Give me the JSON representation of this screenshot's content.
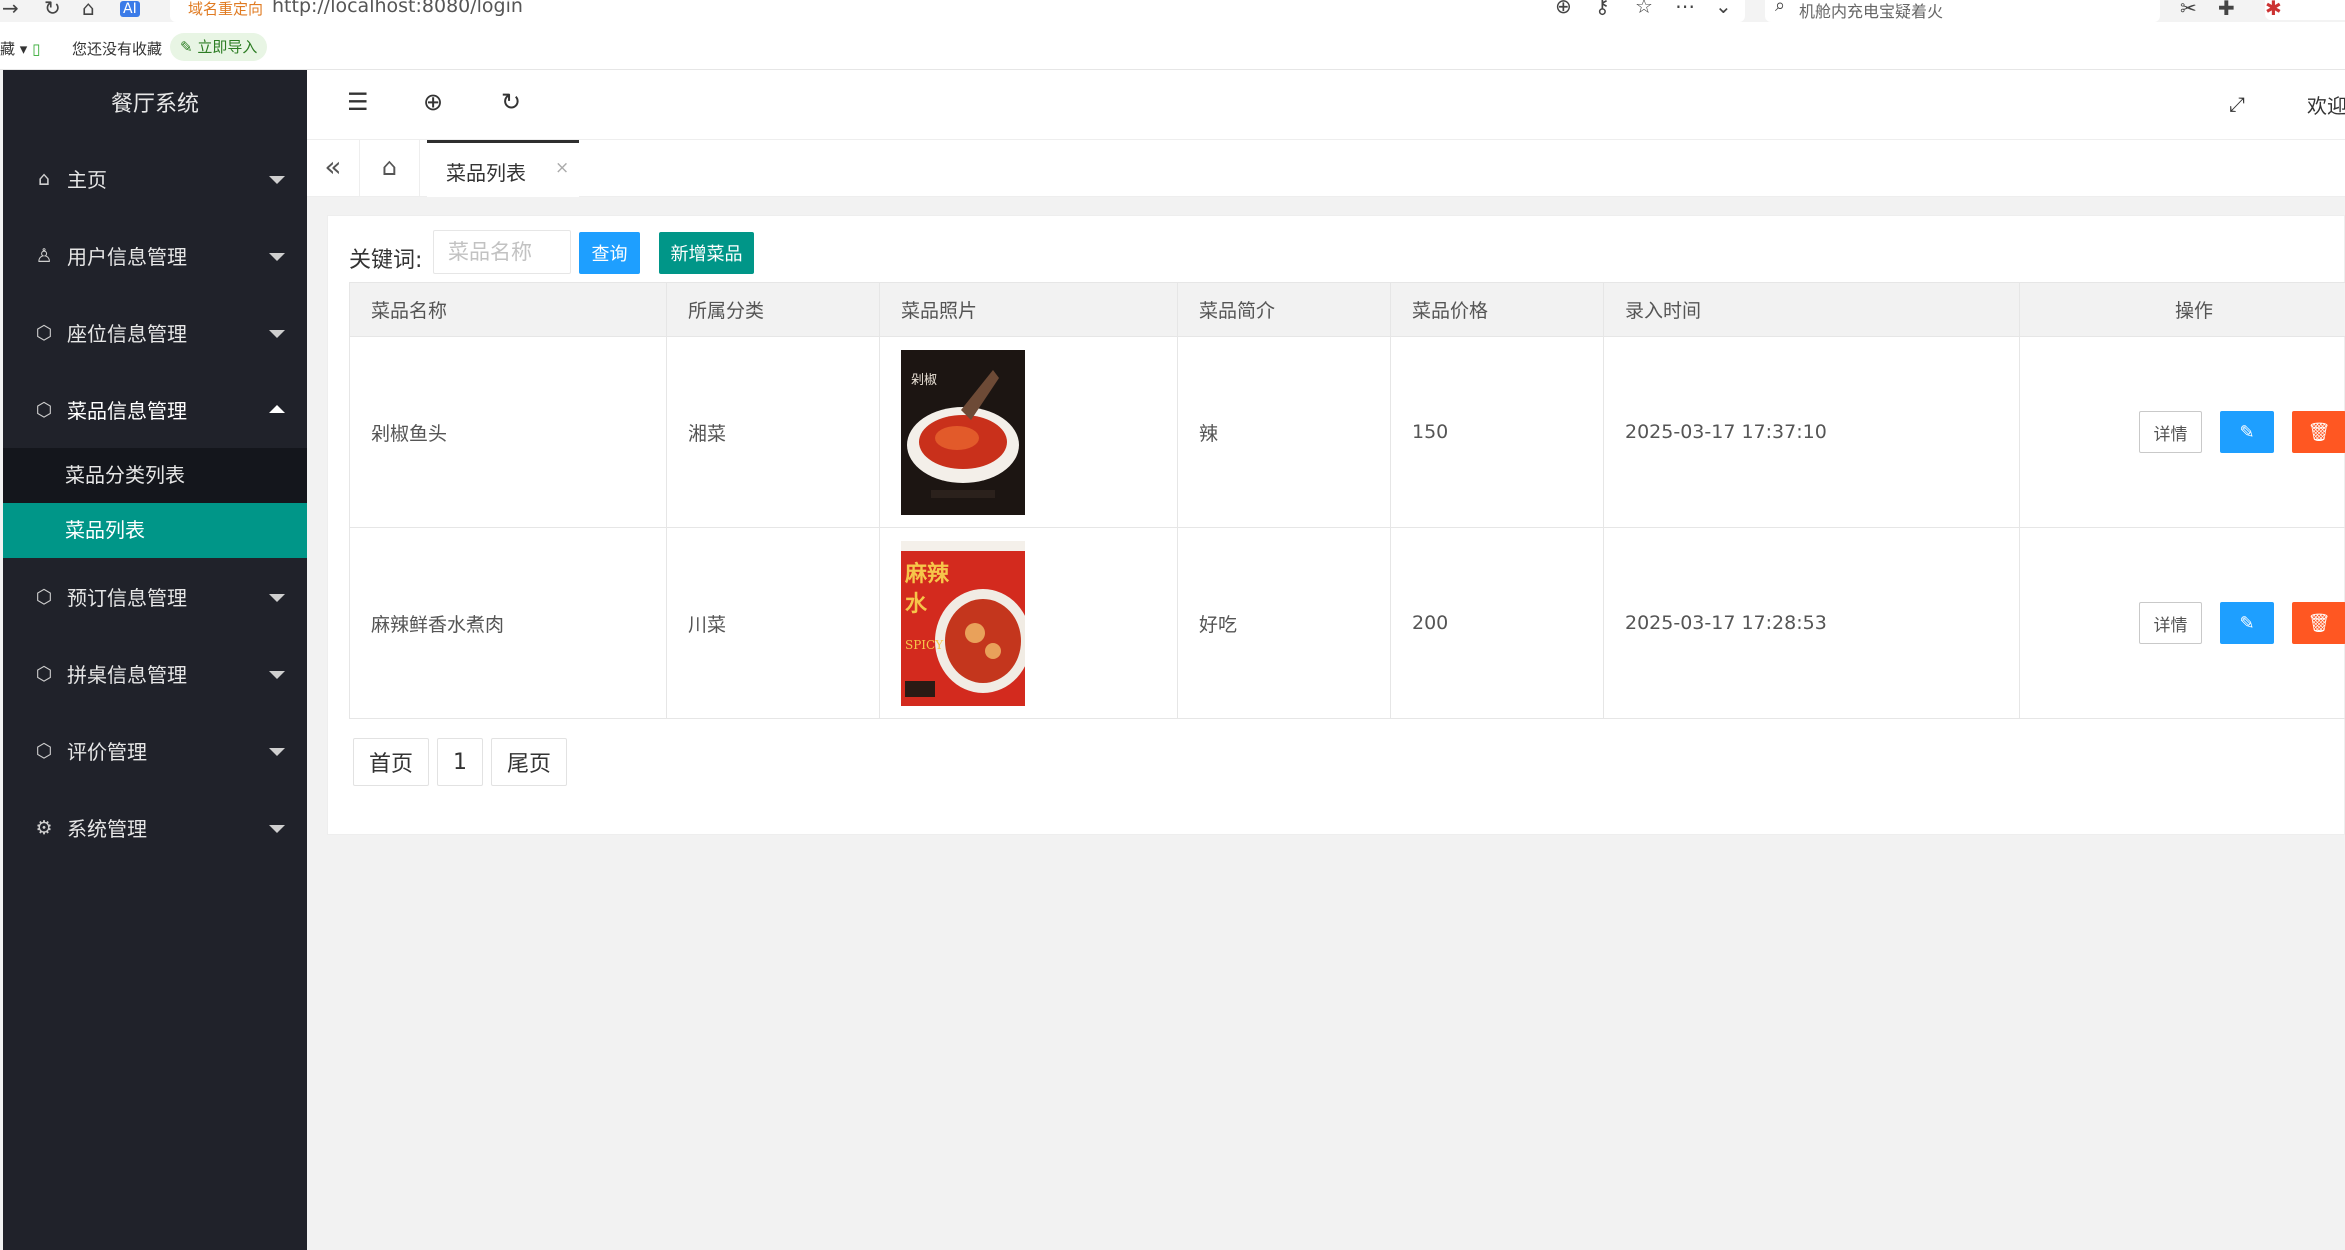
{
  "browser": {
    "address_warning": "域名重定向",
    "url": "http://localhost:8080/login",
    "search_text": "机舱内充电宝疑着火",
    "bookmarks_label": "藏",
    "bookmarks_empty": "您还没有收藏",
    "import_label": "立即导入"
  },
  "sidebar": {
    "title": "餐厅系统",
    "items": [
      {
        "label": "主页",
        "icon": "home-icon"
      },
      {
        "label": "用户信息管理",
        "icon": "user-icon"
      },
      {
        "label": "座位信息管理",
        "icon": "cube-icon"
      },
      {
        "label": "菜品信息管理",
        "icon": "cube-icon"
      },
      {
        "label": "预订信息管理",
        "icon": "cube-icon"
      },
      {
        "label": "拼桌信息管理",
        "icon": "cube-icon"
      },
      {
        "label": "评价管理",
        "icon": "cube-icon"
      },
      {
        "label": "系统管理",
        "icon": "gear-icon"
      }
    ],
    "sub_items": [
      {
        "label": "菜品分类列表"
      },
      {
        "label": "菜品列表"
      }
    ]
  },
  "header": {
    "welcome": "欢迎"
  },
  "tabs": {
    "active": "菜品列表",
    "close": "×"
  },
  "search": {
    "label": "关键词:",
    "placeholder": "菜品名称",
    "query_label": "查询",
    "add_label": "新增菜品"
  },
  "table": {
    "columns": [
      "菜品名称",
      "所属分类",
      "菜品照片",
      "菜品简介",
      "菜品价格",
      "录入时间",
      "操作"
    ],
    "rows": [
      {
        "name": "剁椒鱼头",
        "category": "湘菜",
        "intro": "辣",
        "price": "150",
        "time": "2025-03-17 17:37:10"
      },
      {
        "name": "麻辣鲜香水煮肉",
        "category": "川菜",
        "intro": "好吃",
        "price": "200",
        "time": "2025-03-17 17:28:53"
      }
    ],
    "detail_label": "详情"
  },
  "pager": {
    "first": "首页",
    "page": "1",
    "last": "尾页"
  },
  "colors": {
    "sidebar_bg": "#20222a",
    "accent_green": "#009688",
    "accent_blue": "#1e9fff",
    "danger_orange": "#ff5722"
  }
}
